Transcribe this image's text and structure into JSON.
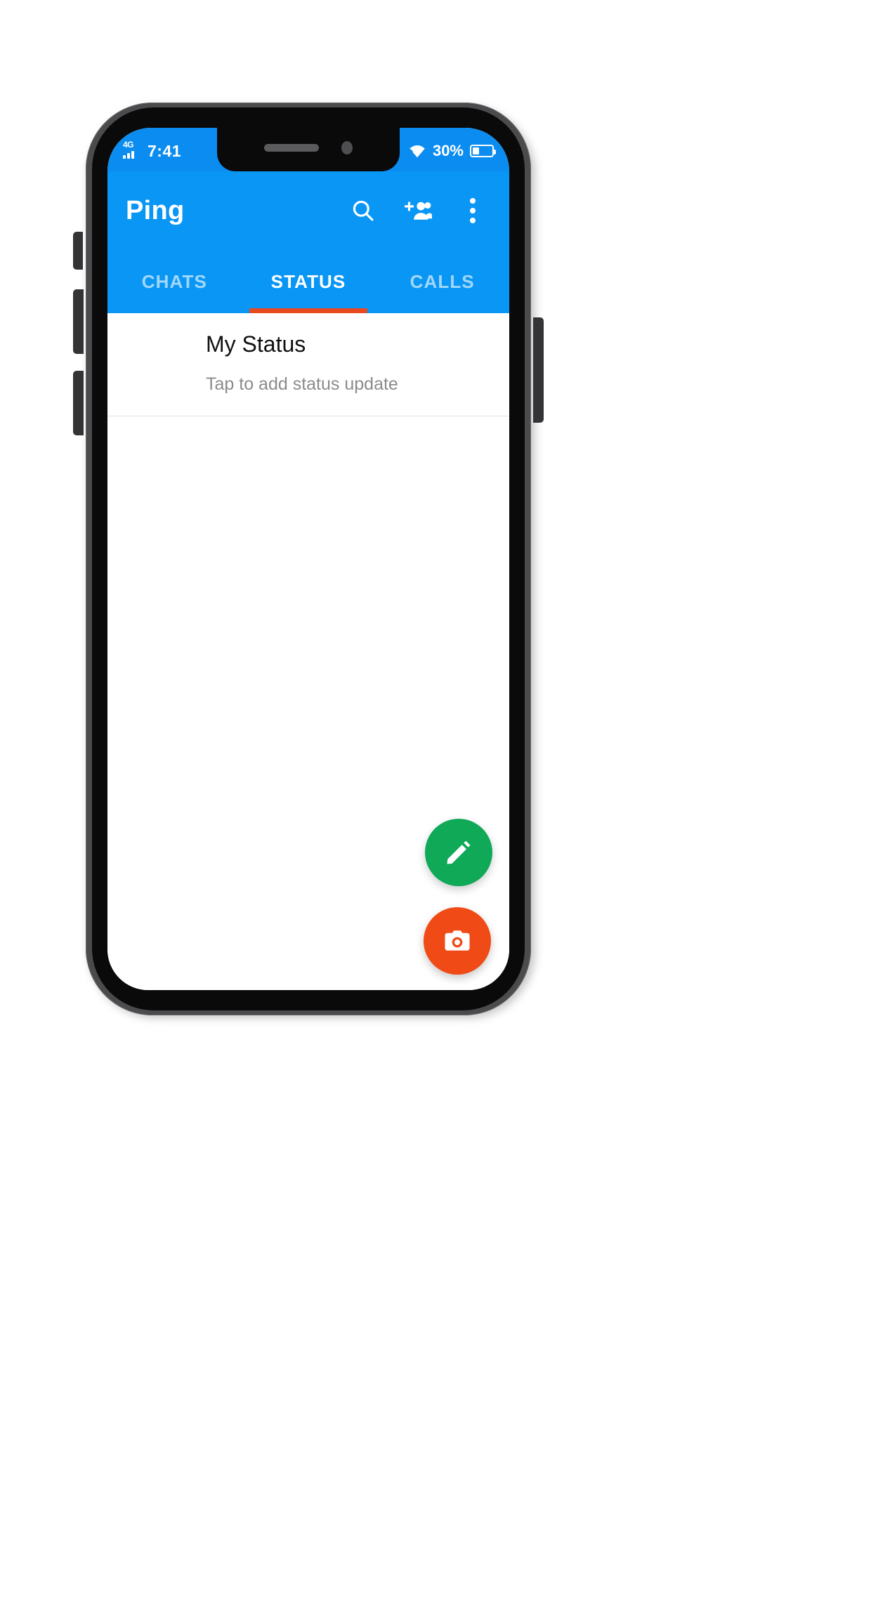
{
  "status_bar": {
    "network_label": "4G",
    "time": "7:41",
    "battery_percent": "30%",
    "signal_icon": "signal-bars-icon",
    "wifi_icon": "wifi-icon",
    "battery_icon": "battery-icon"
  },
  "app_bar": {
    "title": "Ping",
    "actions": [
      {
        "name": "search-icon",
        "label": "Search"
      },
      {
        "name": "add-people-icon",
        "label": "Add people"
      },
      {
        "name": "overflow-menu-icon",
        "label": "More options"
      }
    ]
  },
  "tabs": {
    "items": [
      {
        "label": "CHATS",
        "active": false
      },
      {
        "label": "STATUS",
        "active": true
      },
      {
        "label": "CALLS",
        "active": false
      }
    ],
    "indicator_color": "#e8491e"
  },
  "content": {
    "my_status": {
      "title": "My Status",
      "subtitle": "Tap to add status update"
    }
  },
  "fabs": [
    {
      "name": "edit-status-fab",
      "icon": "pencil-icon",
      "color": "#0fa958"
    },
    {
      "name": "camera-fab",
      "icon": "camera-icon",
      "color": "#f04a16"
    }
  ],
  "colors": {
    "primary_blue": "#0a96f5",
    "status_bar_blue": "#0a8cf0",
    "accent_orange": "#e8491e",
    "fab_green": "#0fa958",
    "fab_orange": "#f04a16"
  }
}
